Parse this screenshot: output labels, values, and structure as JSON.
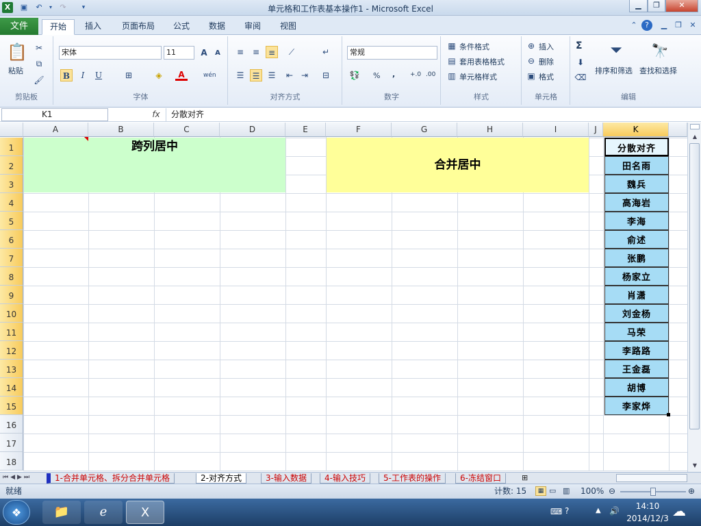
{
  "window": {
    "title": "单元格和工作表基本操作1 - Microsoft Excel",
    "app_icon": "excel-icon"
  },
  "menu": {
    "file": "文件",
    "tabs": [
      "开始",
      "插入",
      "页面布局",
      "公式",
      "数据",
      "审阅",
      "视图"
    ],
    "active_tab": "开始"
  },
  "ribbon": {
    "clipboard": {
      "label": "剪贴板",
      "paste": "粘贴"
    },
    "font": {
      "label": "字体",
      "name": "宋体",
      "size": "11",
      "bold": "B",
      "italic": "I",
      "underline": "U",
      "grow": "A",
      "shrink": "A",
      "color_glyph": "A",
      "wen": "wén"
    },
    "alignment": {
      "label": "对齐方式"
    },
    "number": {
      "label": "数字",
      "format": "常规",
      "percent": "%",
      "comma": ",",
      "dec_inc": "+.0",
      "dec_dec": ".00"
    },
    "styles": {
      "label": "样式",
      "conditional": "条件格式",
      "table": "套用表格格式",
      "cell": "单元格样式"
    },
    "cells": {
      "label": "单元格",
      "insert": "插入",
      "delete": "删除",
      "format": "格式"
    },
    "editing": {
      "label": "编辑",
      "sum": "Σ",
      "sort": "排序和筛选",
      "find": "查找和选择"
    }
  },
  "formula_bar": {
    "name_box": "K1",
    "fx": "fx",
    "content": "分散对齐"
  },
  "grid": {
    "columns": [
      "A",
      "B",
      "C",
      "D",
      "E",
      "F",
      "G",
      "H",
      "I",
      "J",
      "K"
    ],
    "rows": [
      "1",
      "2",
      "3",
      "4",
      "5",
      "6",
      "7",
      "8",
      "9",
      "10",
      "11",
      "12",
      "13",
      "14",
      "15",
      "16",
      "17",
      "18"
    ],
    "selected_col": "K",
    "merged_a": "跨列居中",
    "merged_f": "合并居中",
    "k_cells": [
      "分散对齐",
      "田名雨",
      "魏兵",
      "高海岩",
      "李海",
      "俞述",
      "张鹏",
      "杨家立",
      "肖潇",
      "刘金杨",
      "马荣",
      "李路路",
      "王金磊",
      "胡博",
      "李家烨"
    ],
    "colors": {
      "green": "#ccffcc",
      "yellow": "#ffff99",
      "blue": "#a6dcf5"
    }
  },
  "sheet_tabs": [
    "1-合并单元格、拆分合并单元格",
    "2-对齐方式",
    "3-输入数据",
    "4-输入技巧",
    "5-工作表的操作",
    "6-冻结窗口"
  ],
  "active_sheet": "2-对齐方式",
  "status": {
    "ready": "就绪",
    "count": "计数: 15",
    "zoom": "100%"
  },
  "taskbar": {
    "time": "14:10",
    "date": "2014/12/3"
  }
}
